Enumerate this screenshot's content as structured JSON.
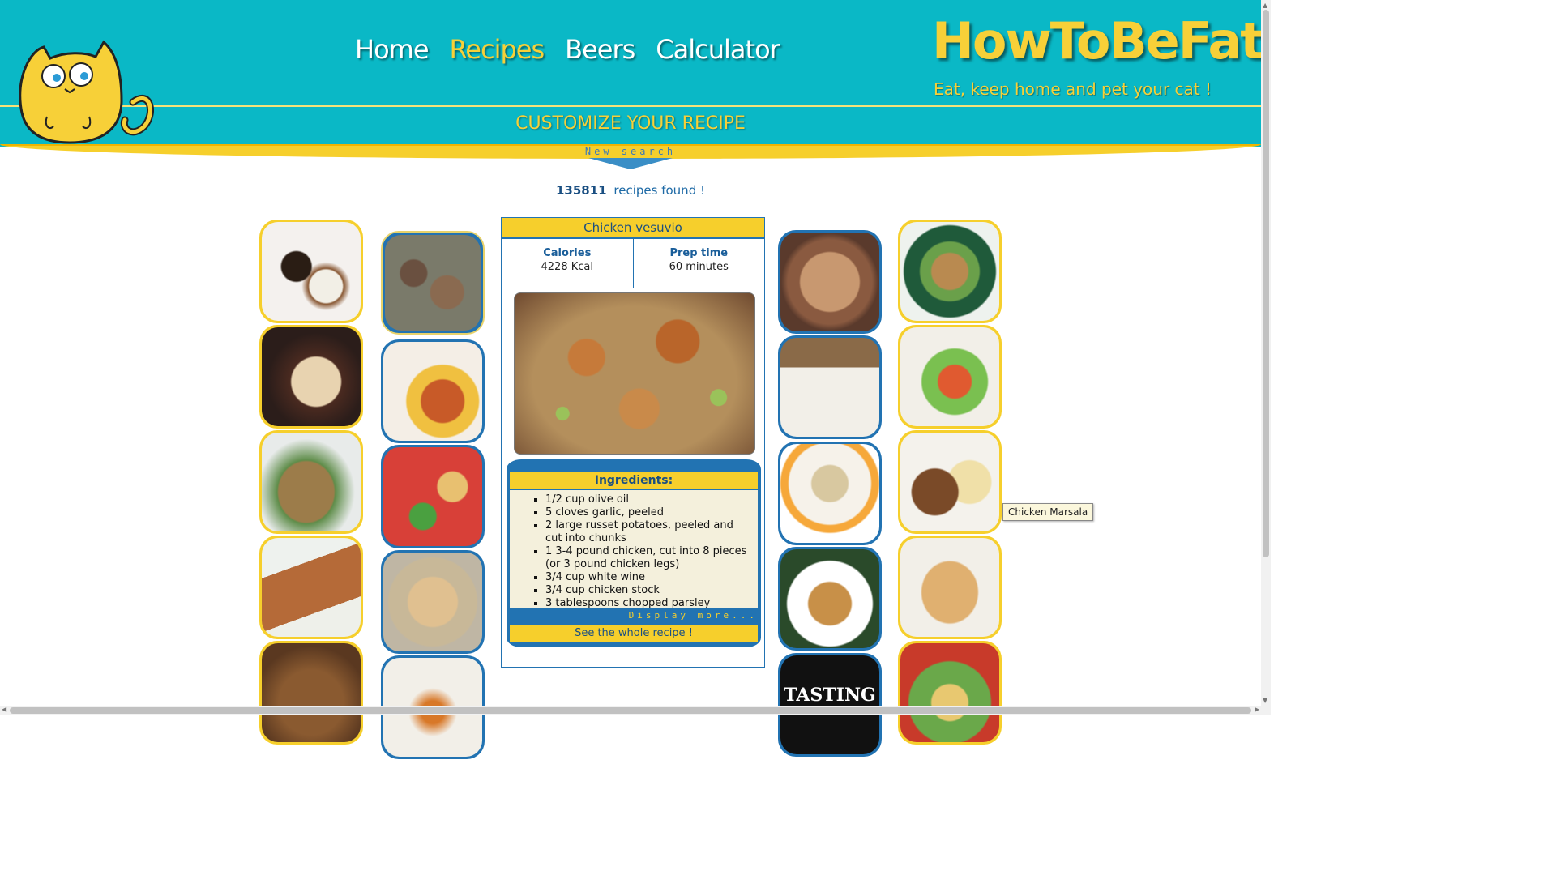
{
  "nav": {
    "items": [
      {
        "label": "Home"
      },
      {
        "label": "Recipes",
        "active": true
      },
      {
        "label": "Beers"
      },
      {
        "label": "Calculator"
      }
    ]
  },
  "brand": {
    "title": "HowToBeFat",
    "tagline": "Eat, keep home and pet your cat !"
  },
  "banner": {
    "customize": "CUSTOMIZE YOUR RECIPE",
    "new_search": "New search"
  },
  "results": {
    "count": "135811",
    "suffix": "recipes found !"
  },
  "recipe": {
    "title": "Chicken vesuvio",
    "calories_label": "Calories",
    "calories_value": "4228 Kcal",
    "prep_label": "Prep time",
    "prep_value": "60 minutes",
    "ingredients_title": "Ingredients:",
    "ingredients": [
      "1/2 cup olive oil",
      "5 cloves garlic, peeled",
      "2 large russet potatoes, peeled and cut into chunks",
      "1 3-4 pound chicken, cut into 8 pieces (or 3 pound chicken legs)",
      "3/4 cup white wine",
      "3/4 cup chicken stock",
      "3 tablespoons chopped parsley"
    ],
    "display_more": "Display more...",
    "see_whole": "See the whole recipe !"
  },
  "tooltip": "Chicken Marsala",
  "thumbnail_logo_text": "TASTING",
  "colors": {
    "header_bg": "#0ab8c6",
    "accent_yellow": "#f6cf2c",
    "accent_blue": "#2273b2"
  }
}
